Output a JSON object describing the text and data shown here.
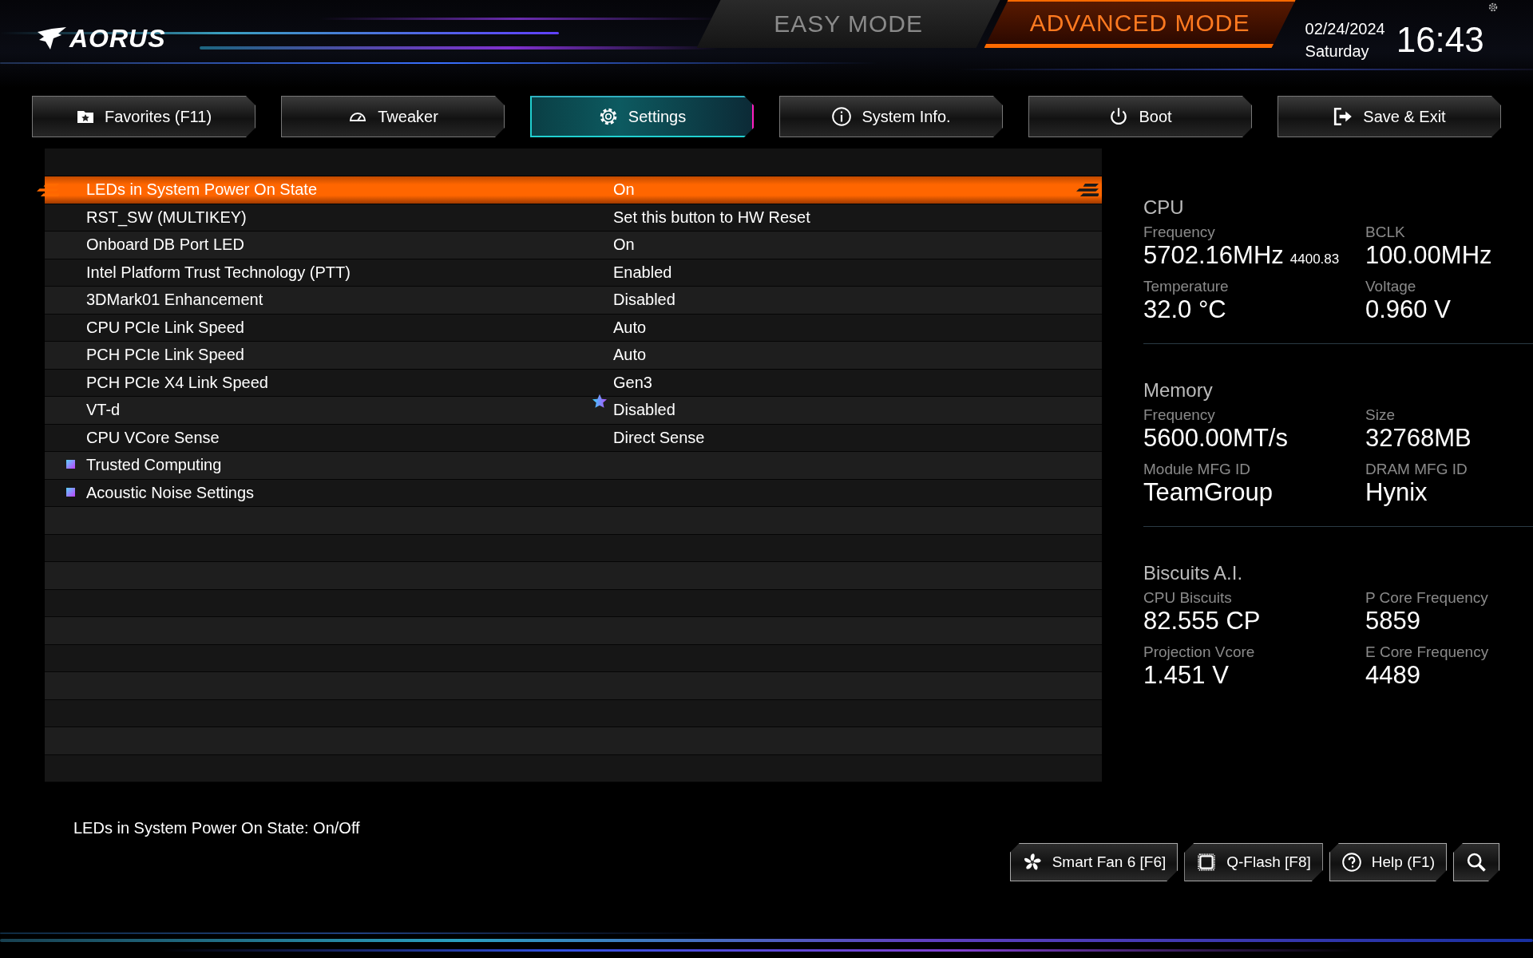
{
  "header": {
    "logo": "AORUS",
    "modes": [
      {
        "label": "EASY MODE",
        "selected": false
      },
      {
        "label": "ADVANCED MODE",
        "selected": true
      }
    ],
    "date": "02/24/2024",
    "weekday": "Saturday",
    "time": "16:43"
  },
  "tabs": [
    {
      "label": "Favorites (F11)",
      "selected": false
    },
    {
      "label": "Tweaker",
      "selected": false
    },
    {
      "label": "Settings",
      "selected": true
    },
    {
      "label": "System Info.",
      "selected": false
    },
    {
      "label": "Boot",
      "selected": false
    },
    {
      "label": "Save & Exit",
      "selected": false
    }
  ],
  "settings": [
    {
      "kind": "setting",
      "label": "LEDs in System Power On State",
      "value": "On",
      "selected": true,
      "starred": false
    },
    {
      "kind": "setting",
      "label": "RST_SW (MULTIKEY)",
      "value": "Set this button to HW Reset",
      "selected": false,
      "starred": false
    },
    {
      "kind": "setting",
      "label": "Onboard DB Port LED",
      "value": "On",
      "selected": false,
      "starred": false
    },
    {
      "kind": "setting",
      "label": "Intel Platform Trust Technology (PTT)",
      "value": "Enabled",
      "selected": false,
      "starred": false
    },
    {
      "kind": "setting",
      "label": "3DMark01 Enhancement",
      "value": "Disabled",
      "selected": false,
      "starred": false
    },
    {
      "kind": "setting",
      "label": "CPU PCIe Link Speed",
      "value": "Auto",
      "selected": false,
      "starred": false
    },
    {
      "kind": "setting",
      "label": "PCH PCIe Link Speed",
      "value": "Auto",
      "selected": false,
      "starred": false
    },
    {
      "kind": "setting",
      "label": "PCH PCIe X4 Link Speed",
      "value": "Gen3",
      "selected": false,
      "starred": false
    },
    {
      "kind": "setting",
      "label": "VT-d",
      "value": "Disabled",
      "selected": false,
      "starred": true
    },
    {
      "kind": "setting",
      "label": "CPU VCore Sense",
      "value": "Direct Sense",
      "selected": false,
      "starred": false
    },
    {
      "kind": "submenu",
      "label": "Trusted Computing",
      "selected": false
    },
    {
      "kind": "submenu",
      "label": "Acoustic Noise Settings",
      "selected": false
    }
  ],
  "help_text": "LEDs in System Power On State: On/Off",
  "info_panel": [
    {
      "title": "CPU",
      "items": [
        {
          "label": "Frequency",
          "value": "5702.16MHz",
          "note": "4400.83"
        },
        {
          "label": "BCLK",
          "value": "100.00MHz"
        },
        {
          "label": "Temperature",
          "value": "32.0 °C"
        },
        {
          "label": "Voltage",
          "value": "0.960 V"
        }
      ]
    },
    {
      "title": "Memory",
      "items": [
        {
          "label": "Frequency",
          "value": "5600.00MT/s"
        },
        {
          "label": "Size",
          "value": "32768MB"
        },
        {
          "label": "Module MFG ID",
          "value": "TeamGroup"
        },
        {
          "label": "DRAM MFG ID",
          "value": "Hynix"
        }
      ]
    },
    {
      "title": "Biscuits A.I.",
      "items": [
        {
          "label": "CPU Biscuits",
          "value": "82.555 CP"
        },
        {
          "label": "P Core Frequency",
          "value": "5859"
        },
        {
          "label": "Projection Vcore",
          "value": "1.451 V"
        },
        {
          "label": "E Core Frequency",
          "value": "4489"
        }
      ]
    }
  ],
  "bottom_buttons": [
    {
      "kind": "fan",
      "label": "Smart Fan 6 [F6]"
    },
    {
      "kind": "flash",
      "label": "Q-Flash [F8]"
    },
    {
      "kind": "help",
      "label": "Help (F1)"
    },
    {
      "kind": "search"
    }
  ]
}
